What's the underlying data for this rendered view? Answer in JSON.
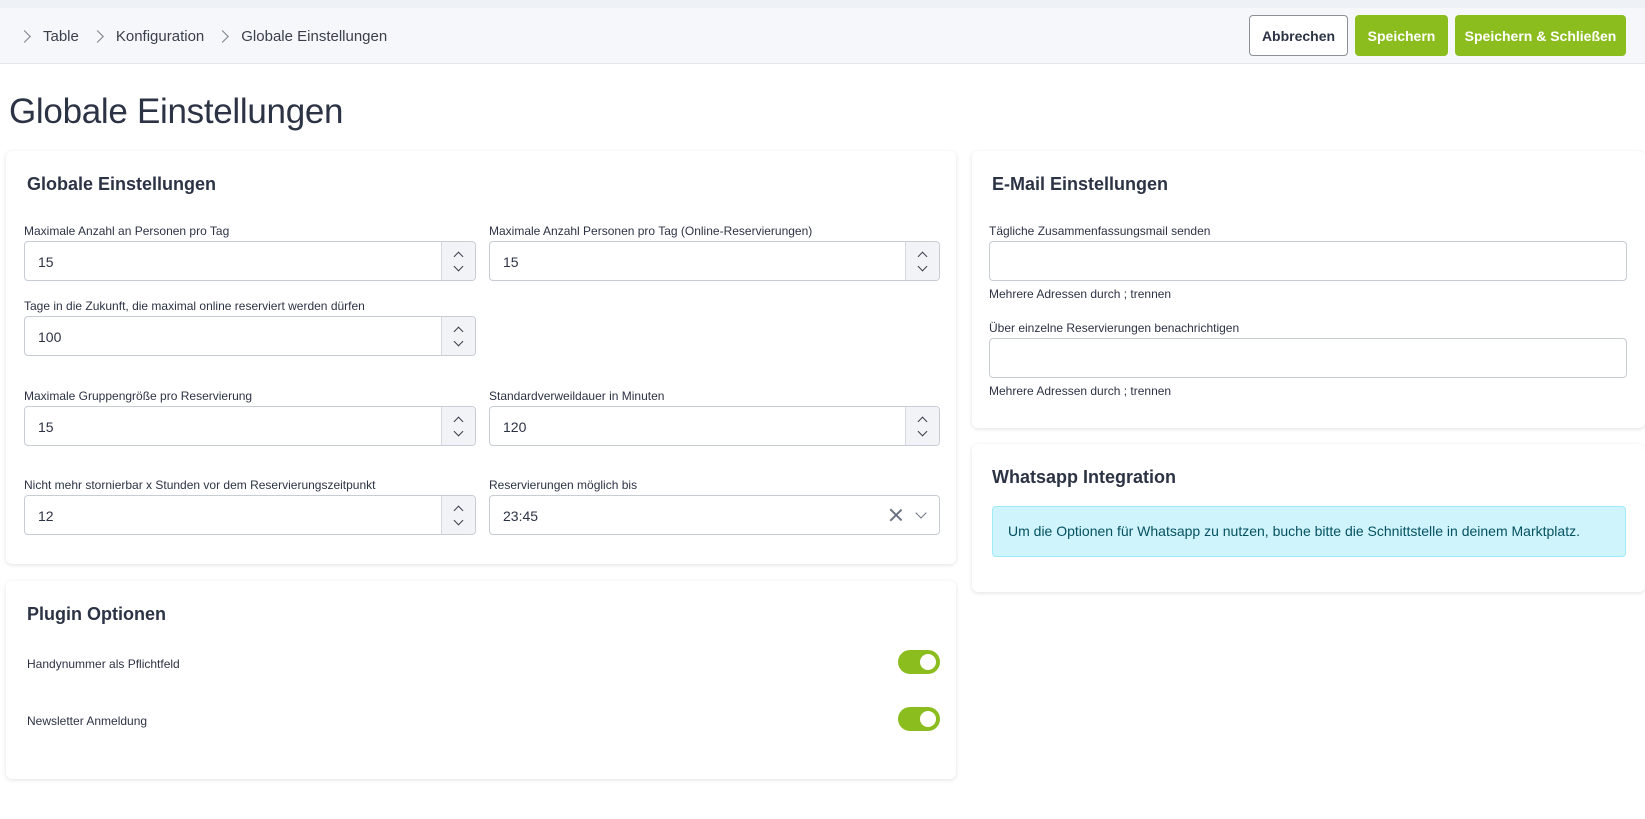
{
  "breadcrumb": [
    "Table",
    "Konfiguration",
    "Globale Einstellungen"
  ],
  "toolbar": {
    "cancel_label": "Abbrechen",
    "save_label": "Speichern",
    "save_close_label": "Speichern & Schließen"
  },
  "page_title": "Globale Einstellungen",
  "global_settings": {
    "title": "Globale Einstellungen",
    "fields": {
      "max_persons_day": {
        "label": "Maximale Anzahl an Personen pro Tag",
        "value": "15"
      },
      "max_persons_online": {
        "label": "Maximale Anzahl Personen pro Tag (Online-Reservierungen)",
        "value": "15"
      },
      "days_future": {
        "label": "Tage in die Zukunft, die maximal online reserviert werden dürfen",
        "value": "100"
      },
      "max_group": {
        "label": "Maximale Gruppengröße pro Reservierung",
        "value": "15"
      },
      "default_duration": {
        "label": "Standardverweildauer in Minuten",
        "value": "120"
      },
      "cancel_hours": {
        "label": "Nicht mehr stornierbar x Stunden vor dem Reservierungszeitpunkt",
        "value": "12"
      },
      "reservations_until": {
        "label": "Reservierungen möglich bis",
        "value": "23:45"
      }
    }
  },
  "plugin_options": {
    "title": "Plugin Optionen",
    "toggles": [
      {
        "label": "Handynummer als Pflichtfeld",
        "on": true
      },
      {
        "label": "Newsletter Anmeldung",
        "on": true
      }
    ]
  },
  "email_settings": {
    "title": "E-Mail Einstellungen",
    "daily_summary": {
      "label": "Tägliche Zusammenfassungsmail senden",
      "value": "",
      "hint": "Mehrere Adressen durch ; trennen"
    },
    "single_notify": {
      "label": "Über einzelne Reservierungen benachrichtigen",
      "value": "",
      "hint": "Mehrere Adressen durch ; trennen"
    }
  },
  "whatsapp": {
    "title": "Whatsapp Integration",
    "info": "Um die Optionen für Whatsapp zu nutzen, buche bitte die Schnittstelle in deinem Marktplatz."
  },
  "colors": {
    "accent": "#8cbd1f",
    "info_bg": "#cff4fc",
    "info_text": "#055160"
  }
}
